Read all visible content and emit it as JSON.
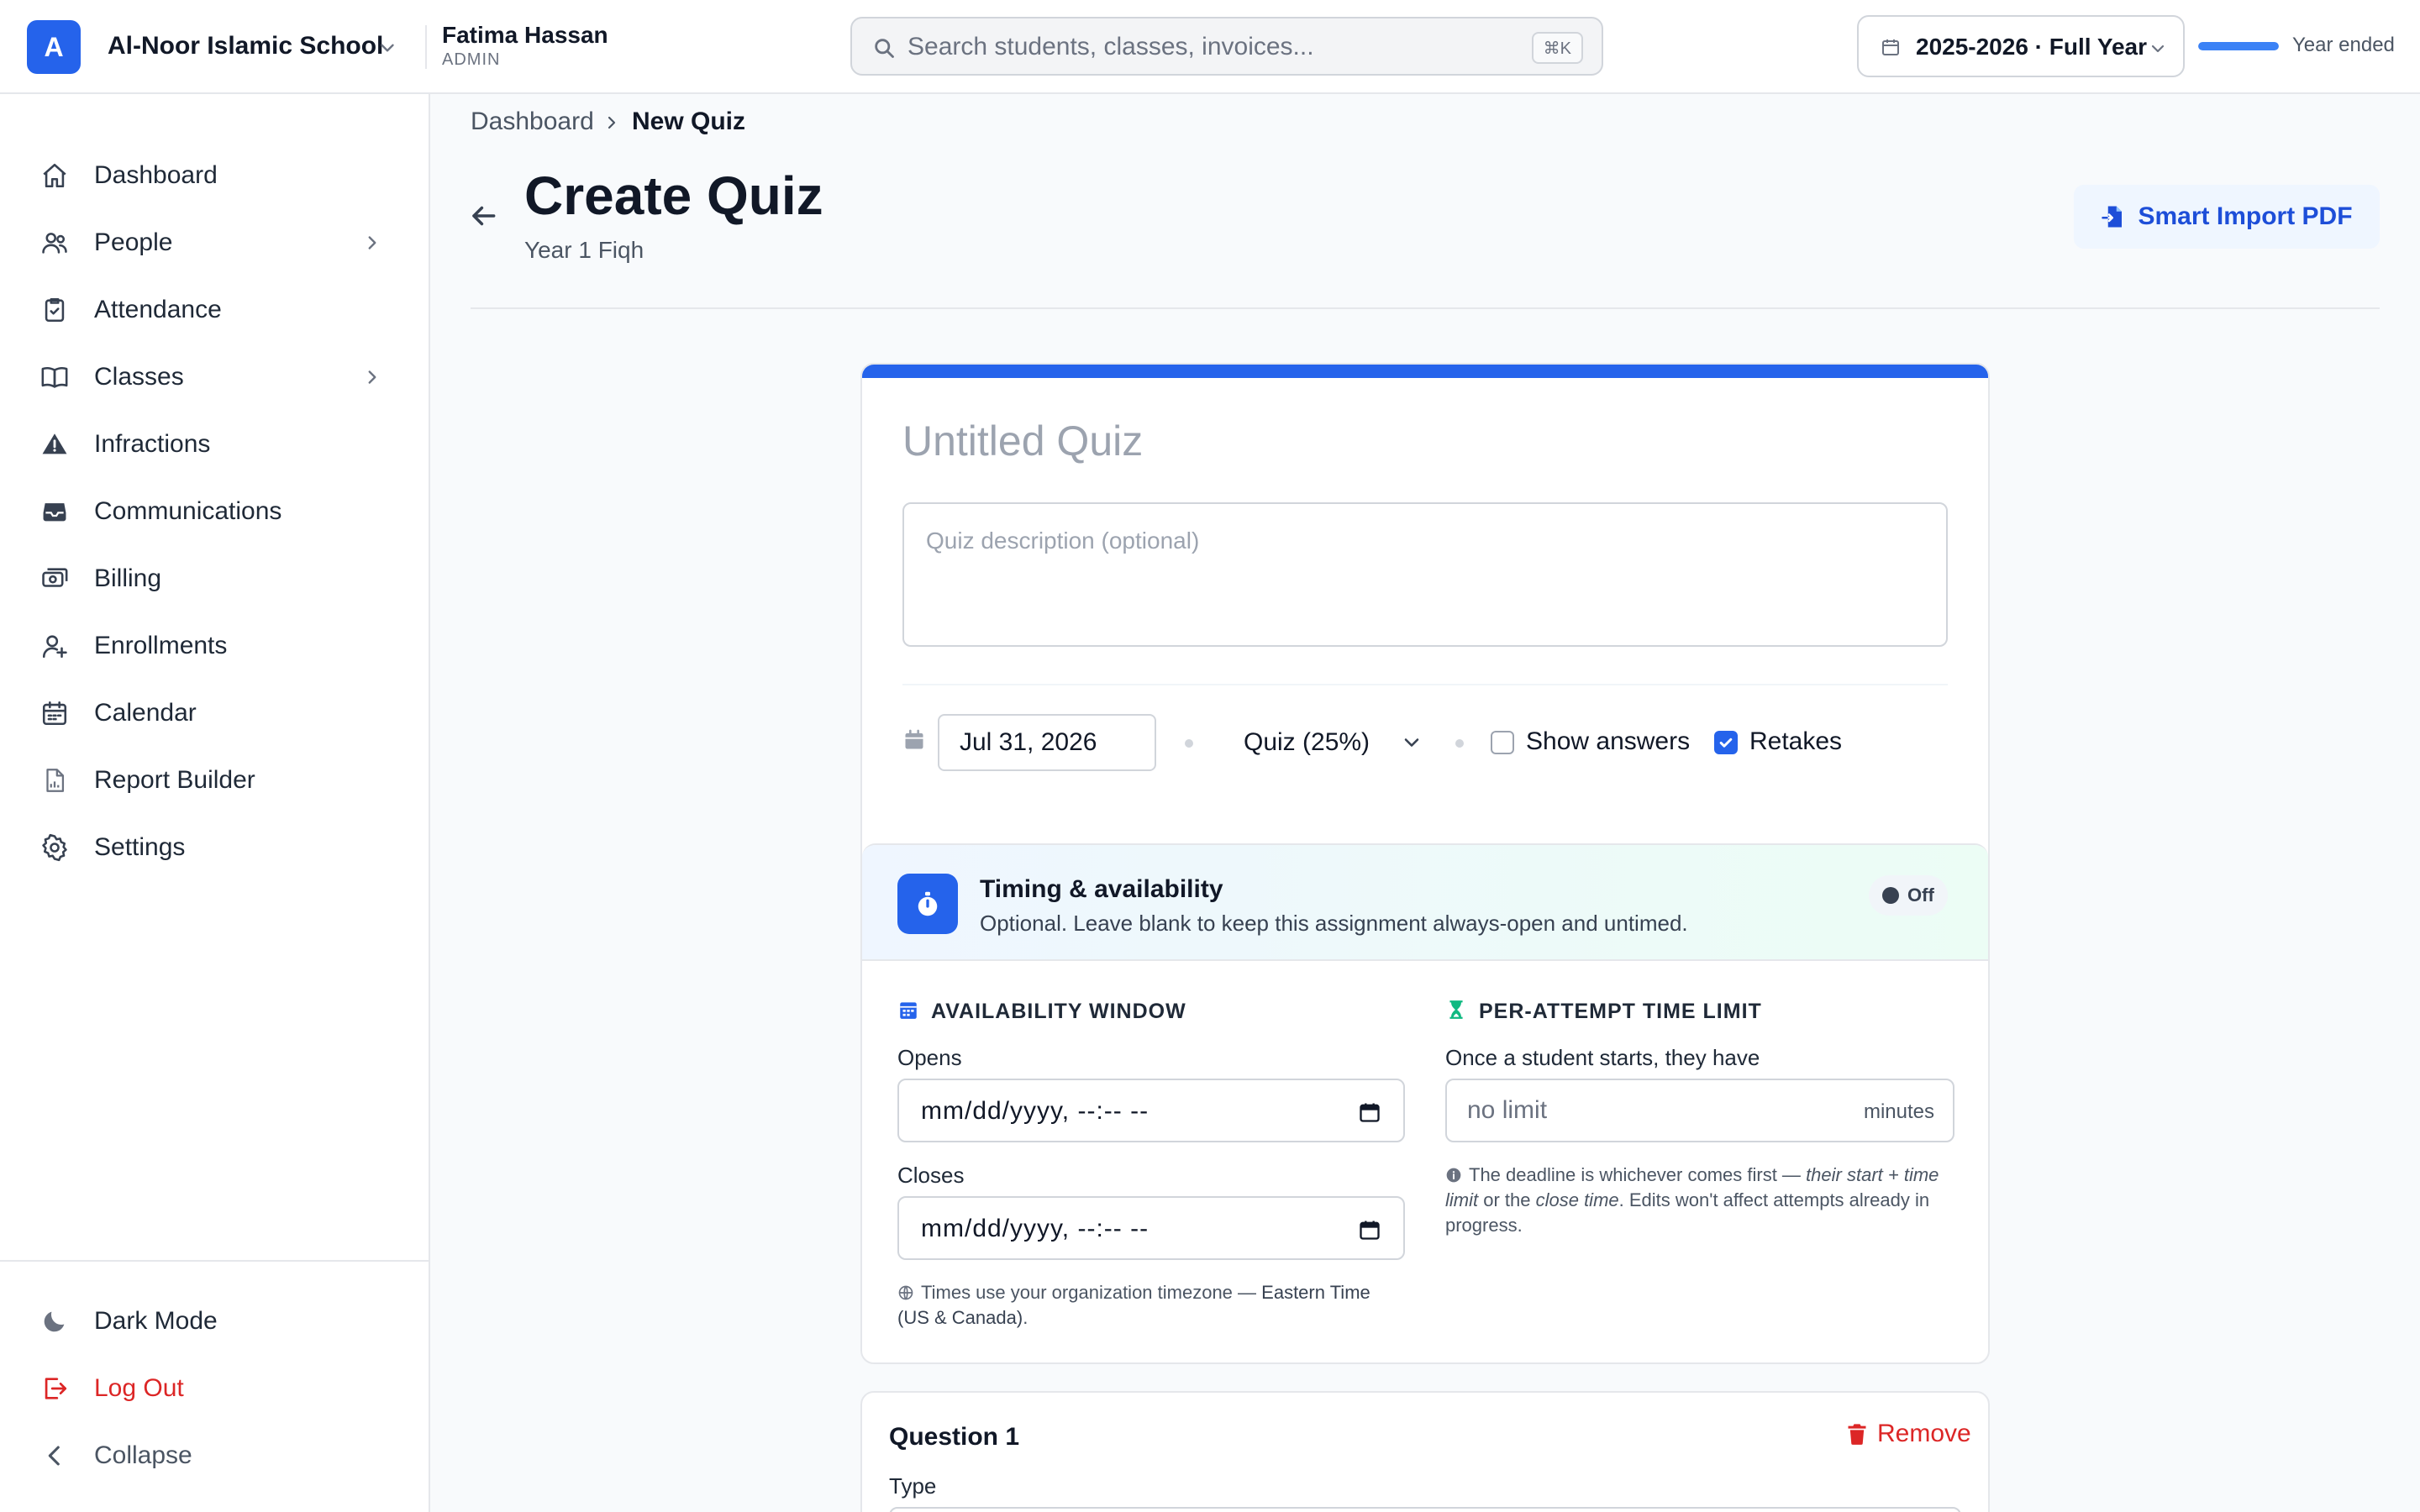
{
  "topbar": {
    "org_initial": "A",
    "org_name": "Al-Noor Islamic School",
    "user_name": "Fatima Hassan",
    "user_role": "ADMIN",
    "search_placeholder": "Search students, classes, invoices...",
    "search_shortcut": "⌘K",
    "school_year": "2025-2026 · Full Year",
    "year_progress_percent": 100,
    "year_status": "Year ended"
  },
  "sidebar": {
    "items": [
      {
        "label": "Dashboard",
        "icon": "home-icon"
      },
      {
        "label": "People",
        "icon": "users-icon",
        "expandable": true
      },
      {
        "label": "Attendance",
        "icon": "clipboard-check-icon"
      },
      {
        "label": "Classes",
        "icon": "book-open-icon",
        "expandable": true
      },
      {
        "label": "Infractions",
        "icon": "warning-icon"
      },
      {
        "label": "Communications",
        "icon": "inbox-icon"
      },
      {
        "label": "Billing",
        "icon": "cash-icon"
      },
      {
        "label": "Enrollments",
        "icon": "user-plus-icon"
      },
      {
        "label": "Calendar",
        "icon": "calendar-icon"
      },
      {
        "label": "Report Builder",
        "icon": "document-chart-icon"
      },
      {
        "label": "Settings",
        "icon": "gear-icon"
      }
    ],
    "dark_mode": "Dark Mode",
    "logout": "Log Out",
    "collapse": "Collapse"
  },
  "breadcrumb": {
    "parent": "Dashboard",
    "current": "New Quiz"
  },
  "header": {
    "title": "Create Quiz",
    "subtitle": "Year 1 Fiqh",
    "smart_import": "Smart Import PDF"
  },
  "quiz": {
    "title_placeholder": "Untitled Quiz",
    "description_placeholder": "Quiz description (optional)",
    "due_date": "Jul 31, 2026",
    "category": "Quiz (25%)",
    "show_answers_label": "Show answers",
    "show_answers_checked": false,
    "retakes_label": "Retakes",
    "retakes_checked": true
  },
  "timing": {
    "title": "Timing & availability",
    "description": "Optional. Leave blank to keep this assignment always-open and untimed.",
    "toggle_state": "Off",
    "availability_title": "AVAILABILITY WINDOW",
    "opens_label": "Opens",
    "opens_value": "mm/dd/yyyy, --:-- --",
    "closes_label": "Closes",
    "closes_value": "mm/dd/yyyy, --:-- --",
    "tz_note_prefix": "Times use your organization timezone — ",
    "tz_name": "Eastern Time (US & Canada)",
    "tz_suffix": ".",
    "limit_title": "PER-ATTEMPT TIME LIMIT",
    "limit_label": "Once a student starts, they have",
    "limit_placeholder": "no limit",
    "limit_unit": "minutes",
    "limit_note_1": "The deadline is whichever comes first — ",
    "limit_note_em1": "their start + time limit",
    "limit_note_2": " or the ",
    "limit_note_em2": "close time",
    "limit_note_3": ". Edits won't affect attempts already in progress."
  },
  "question": {
    "title": "Question 1",
    "remove": "Remove",
    "type_label": "Type"
  },
  "colors": {
    "accent": "#2563eb",
    "danger": "#dc2626",
    "success": "#10b981"
  }
}
